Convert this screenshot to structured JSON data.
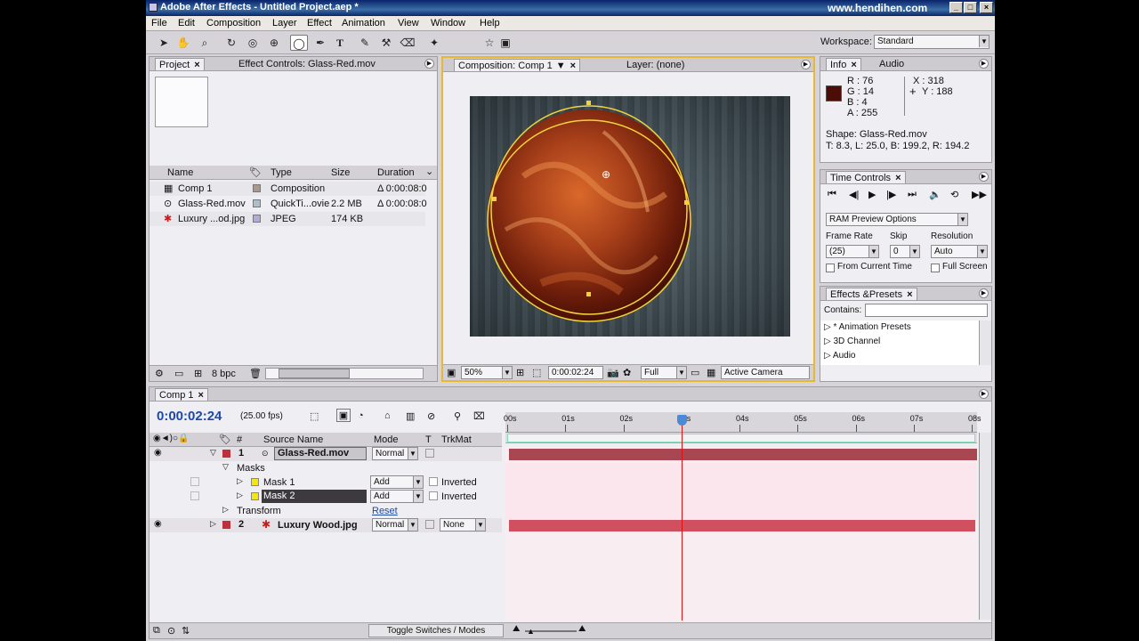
{
  "title": "Adobe After Effects - Untitled Project.aep *",
  "watermark": "www.hendihen.com",
  "menu": [
    "File",
    "Edit",
    "Composition",
    "Layer",
    "Effect",
    "Animation",
    "View",
    "Window",
    "Help"
  ],
  "workspace": {
    "label": "Workspace:",
    "value": "Standard"
  },
  "project_panel": {
    "tabs": [
      "Project",
      "Effect Controls: Glass-Red.mov"
    ],
    "columns": {
      "name": "Name",
      "type": "Type",
      "size": "Size",
      "duration": "Duration"
    },
    "items": [
      {
        "name": "Comp 1",
        "type": "Composition",
        "size": "",
        "duration": "Δ 0:00:08:0",
        "color": "#a89a8c",
        "icon": "composition-icon"
      },
      {
        "name": "Glass-Red.mov",
        "type": "QuickTi...ovie",
        "size": "2.2 MB",
        "duration": "Δ 0:00:08:0",
        "color": "#a8c0d0",
        "icon": "quicktime-icon"
      },
      {
        "name": "Luxury ...od.jpg",
        "type": "JPEG",
        "size": "174 KB",
        "duration": "",
        "color": "#b0acd6",
        "icon": "image-icon"
      }
    ],
    "bpc": "8 bpc"
  },
  "comp_panel": {
    "tabs": [
      "Composition: Comp 1",
      "Layer: (none)"
    ],
    "zoom": "50%",
    "time": "0:00:02:24",
    "resolution": "Full",
    "camera": "Active Camera"
  },
  "info_panel": {
    "tabs": [
      "Info",
      "Audio"
    ],
    "rgba": {
      "r": "R : 76",
      "g": "G : 14",
      "b": "B : 4",
      "a": "A : 255"
    },
    "x": "X : 318",
    "y": "Y : 188",
    "swatch_color": "#4c0e04",
    "shape": "Shape: Glass-Red.mov",
    "bounds": "T: 8.3, L: 25.0, B: 199.2, R: 194.2"
  },
  "time_controls": {
    "tab": "Time Controls",
    "ram_preview": "RAM Preview Options",
    "frame_rate_label": "Frame Rate",
    "frame_rate": "(25)",
    "skip_label": "Skip",
    "skip": "0",
    "resolution_label": "Resolution",
    "resolution": "Auto",
    "from_current": "From Current Time",
    "full_screen": "Full Screen"
  },
  "effects_panel": {
    "tab": "Effects &Presets",
    "contains_label": "Contains:",
    "items": [
      "* Animation Presets",
      "3D Channel",
      "Audio"
    ]
  },
  "timeline": {
    "tab": "Comp 1",
    "timecode": "0:00:02:24",
    "fps": "(25.00 fps)",
    "columns": {
      "num": "#",
      "source": "Source Name",
      "mode": "Mode",
      "t": "T",
      "trkmat": "TrkMat"
    },
    "ruler": [
      "00s",
      "01s",
      "02s",
      "03s",
      "04s",
      "05s",
      "06s",
      "07s",
      "08s"
    ],
    "playhead_seconds": 3,
    "duration_seconds": 8,
    "layers": [
      {
        "num": "1",
        "name": "Glass-Red.mov",
        "mode": "Normal"
      },
      {
        "num": "2",
        "name": "Luxury Wood.jpg",
        "mode": "Normal",
        "trkmat": "None"
      }
    ],
    "masks_label": "Masks",
    "masks": [
      {
        "name": "Mask 1",
        "mode": "Add",
        "inverted": "Inverted"
      },
      {
        "name": "Mask 2",
        "mode": "Add",
        "inverted": "Inverted"
      }
    ],
    "transform": "Transform",
    "reset": "Reset",
    "toggle": "Toggle Switches / Modes"
  }
}
